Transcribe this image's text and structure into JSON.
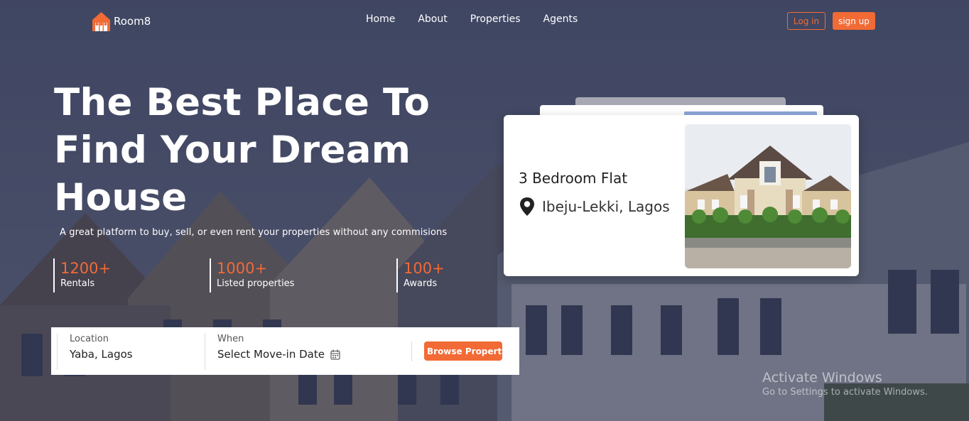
{
  "brand": {
    "name": "Room8",
    "accent": "#f26a35"
  },
  "nav": {
    "links": [
      "Home",
      "About",
      "Properties",
      "Agents"
    ],
    "login_label": "Log in",
    "signup_label": "sign up"
  },
  "hero": {
    "title": "The Best Place To Find Your Dream House",
    "subtitle": "A great platform to buy, sell, or even rent your properties without any commisions",
    "stats": [
      {
        "value": "1200+",
        "label": "Rentals"
      },
      {
        "value": "1000+",
        "label": "Listed properties"
      },
      {
        "value": "100+",
        "label": "Awards"
      }
    ]
  },
  "search": {
    "location_label": "Location",
    "location_value": "Yaba, Lagos",
    "when_label": "When",
    "when_value": "Select Move-in Date",
    "browse_label": "Browse Propertie"
  },
  "property_card": {
    "title": "3 Bedroom Flat",
    "location": "Ibeju-Lekki, Lagos"
  },
  "watermark": {
    "title": "Activate Windows",
    "subtitle": "Go to Settings to activate Windows."
  },
  "icons": {
    "logo": "house-logo-icon",
    "calendar": "calendar-icon",
    "location": "map-pin-icon"
  }
}
